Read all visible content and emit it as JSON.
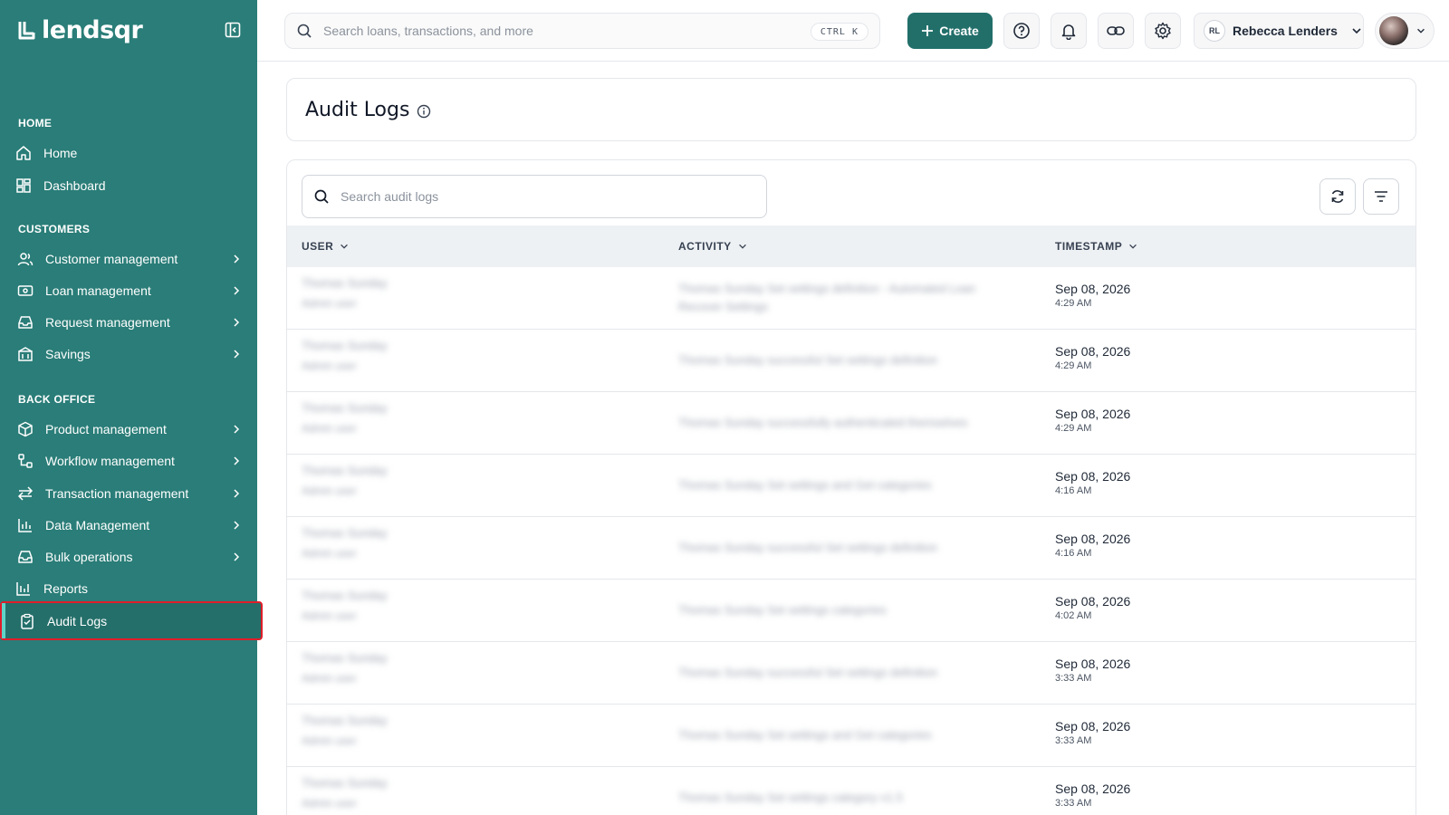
{
  "brand": {
    "name": "lendsqr"
  },
  "sidebar": {
    "sections": {
      "home": "HOME",
      "customers": "CUSTOMERS",
      "back_office": "BACK OFFICE"
    },
    "items": [
      {
        "label": "Home",
        "icon": "home-icon"
      },
      {
        "label": "Dashboard",
        "icon": "dashboard-icon"
      },
      {
        "label": "Customer management",
        "icon": "users-icon"
      },
      {
        "label": "Loan management",
        "icon": "loan-icon"
      },
      {
        "label": "Request management",
        "icon": "inbox-icon"
      },
      {
        "label": "Savings",
        "icon": "savings-icon"
      },
      {
        "label": "Product management",
        "icon": "box-icon"
      },
      {
        "label": "Workflow management",
        "icon": "workflow-icon"
      },
      {
        "label": "Transaction management",
        "icon": "transfer-icon"
      },
      {
        "label": "Data Management",
        "icon": "bar-chart-icon"
      },
      {
        "label": "Bulk operations",
        "icon": "tray-icon"
      },
      {
        "label": "Reports",
        "icon": "reports-icon"
      },
      {
        "label": "Audit Logs",
        "icon": "clipboard-check-icon",
        "active": true
      }
    ]
  },
  "topbar": {
    "search_placeholder": "Search loans, transactions, and more",
    "shortcut": "CTRL  K",
    "create_label": "Create",
    "profile_initials": "RL",
    "profile_name": "Rebecca Lenders"
  },
  "page": {
    "title": "Audit Logs"
  },
  "audit": {
    "search_placeholder": "Search audit logs",
    "columns": {
      "user": "USER",
      "activity": "ACTIVITY",
      "timestamp": "TIMESTAMP"
    },
    "rows": [
      {
        "user": "Thomas Sunday",
        "user_sub": "Admin user",
        "activity": "Thomas Sunday Set settings definition - Automated Loan Recover Settings",
        "date": "Sep 08, 2026",
        "time": "4:29 AM"
      },
      {
        "user": "Thomas Sunday",
        "user_sub": "Admin user",
        "activity": "Thomas Sunday successful Set settings definition",
        "date": "Sep 08, 2026",
        "time": "4:29 AM"
      },
      {
        "user": "Thomas Sunday",
        "user_sub": "Admin user",
        "activity": "Thomas Sunday successfully authenticated themselves",
        "date": "Sep 08, 2026",
        "time": "4:29 AM"
      },
      {
        "user": "Thomas Sunday",
        "user_sub": "Admin user",
        "activity": "Thomas Sunday Set settings and Get categories",
        "date": "Sep 08, 2026",
        "time": "4:16 AM"
      },
      {
        "user": "Thomas Sunday",
        "user_sub": "Admin user",
        "activity": "Thomas Sunday successful Set settings definition",
        "date": "Sep 08, 2026",
        "time": "4:16 AM"
      },
      {
        "user": "Thomas Sunday",
        "user_sub": "Admin user",
        "activity": "Thomas Sunday Set settings categories",
        "date": "Sep 08, 2026",
        "time": "4:02 AM"
      },
      {
        "user": "Thomas Sunday",
        "user_sub": "Admin user",
        "activity": "Thomas Sunday successful Set settings definition",
        "date": "Sep 08, 2026",
        "time": "3:33 AM"
      },
      {
        "user": "Thomas Sunday",
        "user_sub": "Admin user",
        "activity": "Thomas Sunday Set settings and Get categories",
        "date": "Sep 08, 2026",
        "time": "3:33 AM"
      },
      {
        "user": "Thomas Sunday",
        "user_sub": "Admin user",
        "activity": "Thomas Sunday Set settings category v1.5",
        "date": "Sep 08, 2026",
        "time": "3:33 AM"
      }
    ]
  },
  "colors": {
    "sidebar": "#2a7d78",
    "accent": "#226f6a",
    "highlight": "#e11d2a"
  }
}
